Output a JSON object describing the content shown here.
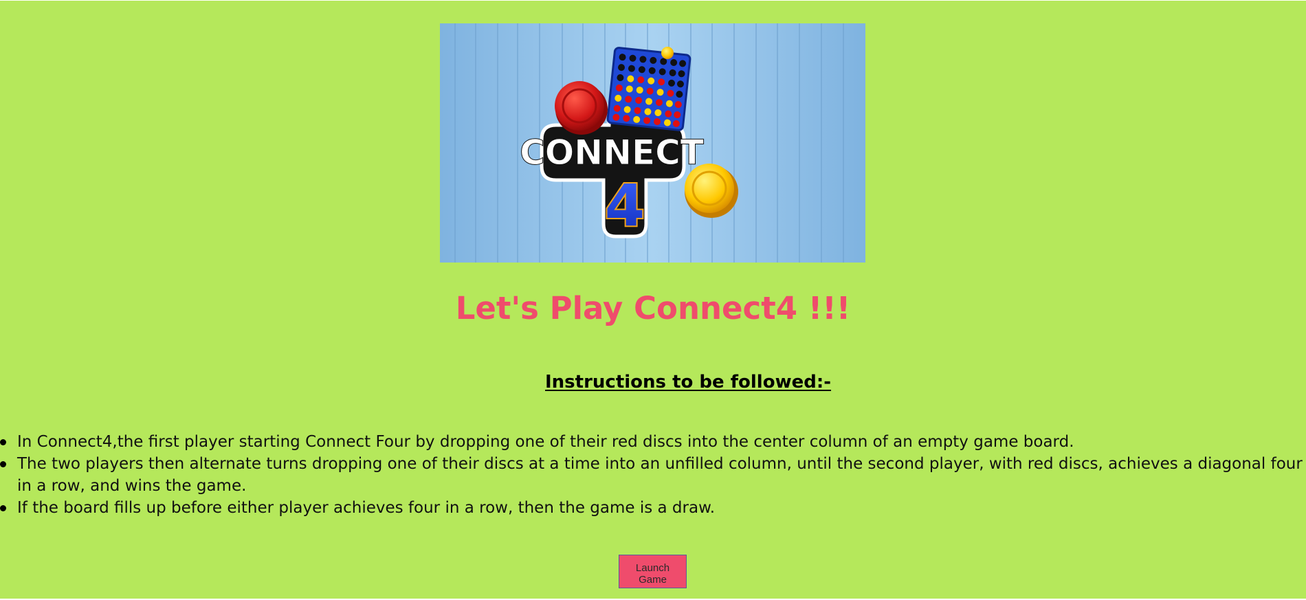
{
  "logo": {
    "word": "CONNECT",
    "number": "4"
  },
  "heading": "Let's Play Connect4 !!!",
  "instructions_title": "Instructions to be followed:-",
  "instructions": [
    "In Connect4,the first player starting Connect Four by dropping one of their red discs into the center column of an empty game board.",
    "The two players then alternate turns dropping one of their discs at a time into an unfilled column, until the second player, with red discs, achieves a diagonal four in a row, and wins the game.",
    "If the board fills up before either player achieves four in a row, then the game is a draw."
  ],
  "launch_button": "Launch Game",
  "colors": {
    "page_background": "#b5e85b",
    "heading": "#ef4c6c",
    "button": "#ef4c6c"
  }
}
